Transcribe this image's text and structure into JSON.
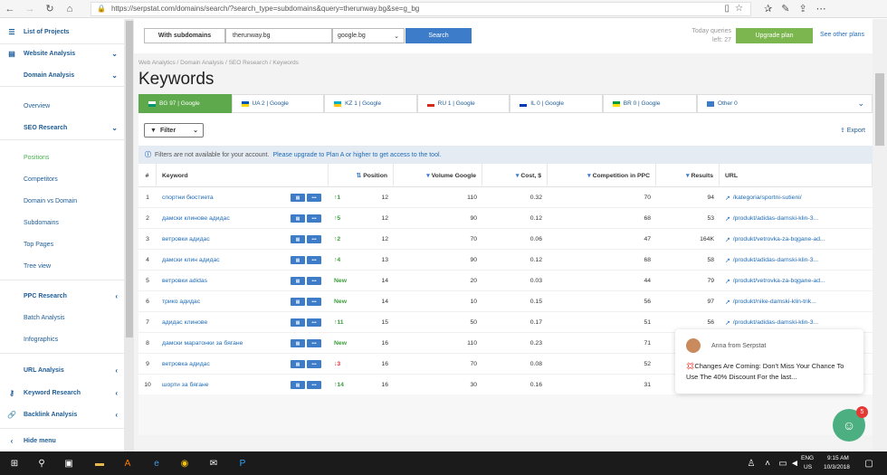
{
  "browser": {
    "url": "https://serpstat.com/domains/search/?search_type=subdomains&query=therunway.bg&se=g_bg"
  },
  "sidebar": {
    "list_of_projects": "List of Projects",
    "website_analysis": "Website Analysis",
    "domain_analysis": "Domain Analysis",
    "overview": "Overview",
    "seo_research": "SEO Research",
    "positions": "Positions",
    "competitors": "Competitors",
    "domain_vs_domain": "Domain vs Domain",
    "subdomains": "Subdomains",
    "top_pages": "Top Pages",
    "tree_view": "Tree view",
    "ppc_research": "PPC Research",
    "batch_analysis": "Batch Analysis",
    "infographics": "Infographics",
    "url_analysis": "URL Analysis",
    "keyword_research": "Keyword Research",
    "backlink_analysis": "Backlink Analysis",
    "hide_menu": "Hide menu"
  },
  "search": {
    "mode": "With subdomains",
    "domain": "therunway.bg",
    "database": "google.bg",
    "button": "Search",
    "queries_line1": "Today queries",
    "queries_line2": "left: 27",
    "upgrade": "Upgrade plan",
    "see_plans": "See other plans"
  },
  "breadcrumb": "Web Analytics / Domain Analysis / SEO Research / Keywords",
  "title": "Keywords",
  "db_tabs": [
    {
      "label": "BG 97 | Google",
      "flag": "#ffffff",
      "flag2": "#00966e"
    },
    {
      "label": "UA 2 | Google",
      "flag": "#0057b7",
      "flag2": "#ffd700"
    },
    {
      "label": "KZ 1 | Google",
      "flag": "#00afca",
      "flag2": "#fec50c"
    },
    {
      "label": "RU 1 | Google",
      "flag": "#ffffff",
      "flag2": "#d52b1e"
    },
    {
      "label": "IL 0 | Google",
      "flag": "#ffffff",
      "flag2": "#0038b8"
    },
    {
      "label": "BR 0 | Google",
      "flag": "#009c3b",
      "flag2": "#ffdf00"
    },
    {
      "label": "Other 0",
      "flag": "#3d7cc9",
      "flag2": "#3d7cc9"
    }
  ],
  "filter": {
    "label": "Filter",
    "export": "Export"
  },
  "notice": {
    "text": "Filters are not available for your account.",
    "link": "Please upgrade to Plan A or higher to get access to the tool."
  },
  "table": {
    "headers": [
      "#",
      "Keyword",
      "Position",
      "Volume Google",
      "Cost, $",
      "Competition in PPC",
      "Results",
      "URL"
    ],
    "rows": [
      {
        "n": "1",
        "kw": "спортни бюстиета",
        "chg": "1",
        "dir": "up",
        "pos": "12",
        "vol": "110",
        "cost": "0.32",
        "comp": "70",
        "res": "94",
        "url": "/kategoria/sportni-sutieni/"
      },
      {
        "n": "2",
        "kw": "дамски клинове адидас",
        "chg": "5",
        "dir": "up",
        "pos": "12",
        "vol": "90",
        "cost": "0.12",
        "comp": "68",
        "res": "53",
        "url": "/produkt/adidas-damski-klin-3..."
      },
      {
        "n": "3",
        "kw": "ветровки адидас",
        "chg": "2",
        "dir": "up",
        "pos": "12",
        "vol": "70",
        "cost": "0.06",
        "comp": "47",
        "res": "164K",
        "url": "/produkt/vetrovka-za-bqgane-ad..."
      },
      {
        "n": "4",
        "kw": "дамски клин адидас",
        "chg": "4",
        "dir": "up",
        "pos": "13",
        "vol": "90",
        "cost": "0.12",
        "comp": "68",
        "res": "58",
        "url": "/produkt/adidas-damski-klin-3..."
      },
      {
        "n": "5",
        "kw": "ветровки adidas",
        "chg": "New",
        "dir": "new",
        "pos": "14",
        "vol": "20",
        "cost": "0.03",
        "comp": "44",
        "res": "79",
        "url": "/produkt/vetrovka-za-bqgane-ad..."
      },
      {
        "n": "6",
        "kw": "трико адидас",
        "chg": "New",
        "dir": "new",
        "pos": "14",
        "vol": "10",
        "cost": "0.15",
        "comp": "56",
        "res": "97",
        "url": "/produkt/nike-damski-klin-trik..."
      },
      {
        "n": "7",
        "kw": "адидас клинове",
        "chg": "11",
        "dir": "up",
        "pos": "15",
        "vol": "50",
        "cost": "0.17",
        "comp": "51",
        "res": "56",
        "url": "/produkt/adidas-damski-klin-3..."
      },
      {
        "n": "8",
        "kw": "дамски маратонки за бягане",
        "chg": "New",
        "dir": "new",
        "pos": "16",
        "vol": "110",
        "cost": "0.23",
        "comp": "71",
        "res": "",
        "url": ""
      },
      {
        "n": "9",
        "kw": "ветровка адидас",
        "chg": "3",
        "dir": "down",
        "pos": "16",
        "vol": "70",
        "cost": "0.08",
        "comp": "52",
        "res": "",
        "url": ""
      },
      {
        "n": "10",
        "kw": "шорти за бягане",
        "chg": "14",
        "dir": "up",
        "pos": "16",
        "vol": "30",
        "cost": "0.16",
        "comp": "31",
        "res": "",
        "url": ""
      }
    ]
  },
  "chat": {
    "who": "Anna from Serpstat",
    "message": "💢Changes Are Coming: Don't Miss Your Chance To Use The 40% Discount For the last...",
    "badge": "5"
  },
  "taskbar": {
    "lang1": "ENG",
    "lang2": "US",
    "time": "9:15 AM",
    "date": "10/3/2018"
  }
}
